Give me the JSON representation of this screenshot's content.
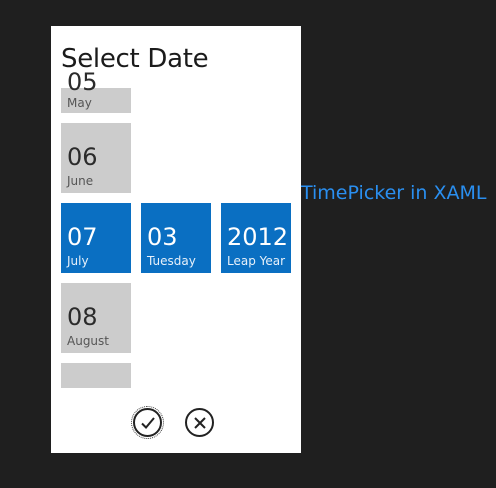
{
  "dialog": {
    "title": "Select Date"
  },
  "month_column": [
    {
      "number": "05",
      "label": "May"
    },
    {
      "number": "06",
      "label": "June"
    },
    {
      "number": "07",
      "label": "July",
      "selected": true
    },
    {
      "number": "08",
      "label": "August"
    },
    {
      "number": "",
      "label": ""
    }
  ],
  "day_tile": {
    "number": "03",
    "label": "Tuesday"
  },
  "year_tile": {
    "number": "2012",
    "label": "Leap Year"
  },
  "buttons": {
    "confirm_icon": "check-icon",
    "cancel_icon": "close-icon"
  },
  "side_text": "TimePicker in XAML",
  "colors": {
    "selected": "#0a6fc2",
    "unselected": "#cccccc",
    "side_text": "#2a8ff0"
  }
}
